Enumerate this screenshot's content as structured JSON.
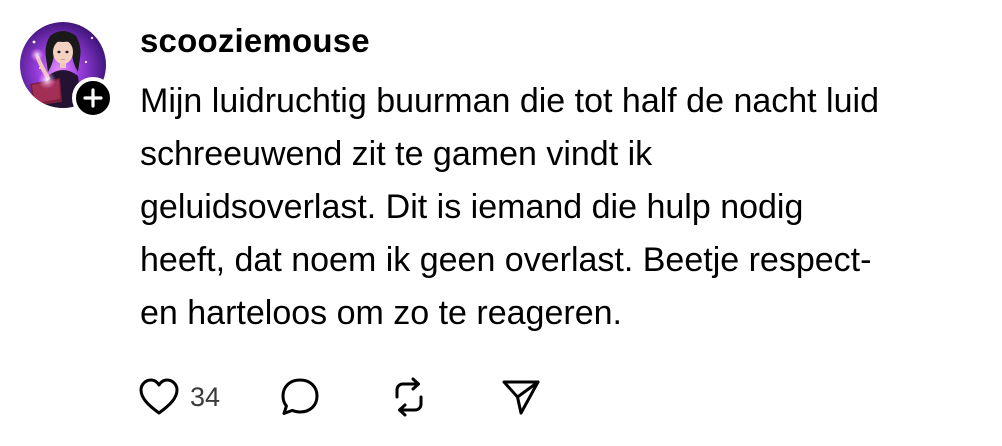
{
  "post": {
    "username": "scooziemouse",
    "text": "Mijn luidruchtig buurman die tot half de nacht luid\nschreeuwend zit te gamen vindt ik\ngeluidsoverlast. Dit is iemand die hulp nodig\nheeft, dat noem ik geen overlast. Beetje respect-\nen harteloos om zo te reageren.",
    "avatar_icon": "avatar-witch-illustration",
    "follow_icon": "plus-icon"
  },
  "actions": {
    "like_icon": "heart-icon",
    "like_count": "34",
    "comment_icon": "speech-bubble-icon",
    "repost_icon": "repost-icon",
    "share_icon": "send-icon"
  },
  "colors": {
    "text": "#000000",
    "count": "#3a3a3a",
    "avatar_bg": "#2a1148",
    "avatar_glow": "#c04bff"
  }
}
